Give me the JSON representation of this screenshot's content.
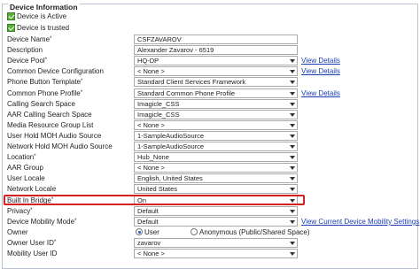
{
  "section": {
    "legend": "Device Information"
  },
  "checkboxes": [
    {
      "label": "Device is Active",
      "checked": true
    },
    {
      "label": "Device is trusted",
      "checked": true
    }
  ],
  "fields": [
    {
      "label": "Device Name",
      "required": "*",
      "value": "CSFZAVAROV",
      "control": "text",
      "link": ""
    },
    {
      "label": "Description",
      "required": "",
      "value": "Alexander Zavarov - 6519",
      "control": "text",
      "link": ""
    },
    {
      "label": "Device Pool",
      "required": "*",
      "value": "HQ-DP",
      "control": "select",
      "link": "View Details"
    },
    {
      "label": "Common Device Configuration",
      "required": "",
      "value": "< None >",
      "control": "select",
      "link": "View Details"
    },
    {
      "label": "Phone Button Template",
      "required": "*",
      "value": "Standard Client Services Framework",
      "control": "select",
      "link": ""
    },
    {
      "label": "Common Phone Profile",
      "required": "*",
      "value": "Standard Common Phone Profile",
      "control": "select",
      "link": "View Details"
    },
    {
      "label": "Calling Search Space",
      "required": "",
      "value": "Imagicle_CSS",
      "control": "select",
      "link": ""
    },
    {
      "label": "AAR Calling Search Space",
      "required": "",
      "value": "Imagicle_CSS",
      "control": "select",
      "link": ""
    },
    {
      "label": "Media Resource Group List",
      "required": "",
      "value": "< None >",
      "control": "select",
      "link": ""
    },
    {
      "label": "User Hold MOH Audio Source",
      "required": "",
      "value": "1-SampleAudioSource",
      "control": "select",
      "link": ""
    },
    {
      "label": "Network Hold MOH Audio Source",
      "required": "",
      "value": "1-SampleAudioSource",
      "control": "select",
      "link": ""
    },
    {
      "label": "Location",
      "required": "*",
      "value": "Hub_None",
      "control": "select",
      "link": ""
    },
    {
      "label": "AAR Group",
      "required": "",
      "value": "< None >",
      "control": "select",
      "link": ""
    },
    {
      "label": "User Locale",
      "required": "",
      "value": "English, United States",
      "control": "select",
      "link": ""
    },
    {
      "label": "Network Locale",
      "required": "",
      "value": "United States",
      "control": "select",
      "link": ""
    },
    {
      "label": "Built In Bridge",
      "required": "*",
      "value": "On",
      "control": "select",
      "link": ""
    },
    {
      "label": "Privacy",
      "required": "*",
      "value": "Default",
      "control": "select",
      "link": ""
    },
    {
      "label": "Device Mobility Mode",
      "required": "*",
      "value": "Default",
      "control": "select",
      "link": "View Current Device Mobility Settings"
    },
    {
      "label": "Owner",
      "required": "",
      "value": "",
      "control": "radio",
      "link": ""
    },
    {
      "label": "Owner User ID",
      "required": "*",
      "value": "zavarov",
      "control": "select",
      "link": ""
    },
    {
      "label": "Mobility User ID",
      "required": "",
      "value": "< None >",
      "control": "select",
      "link": ""
    }
  ],
  "owner_radio": {
    "options": [
      {
        "label": "User",
        "selected": true
      },
      {
        "label": "Anonymous (Public/Shared Space)",
        "selected": false
      }
    ]
  },
  "highlight_color": "#d42020"
}
